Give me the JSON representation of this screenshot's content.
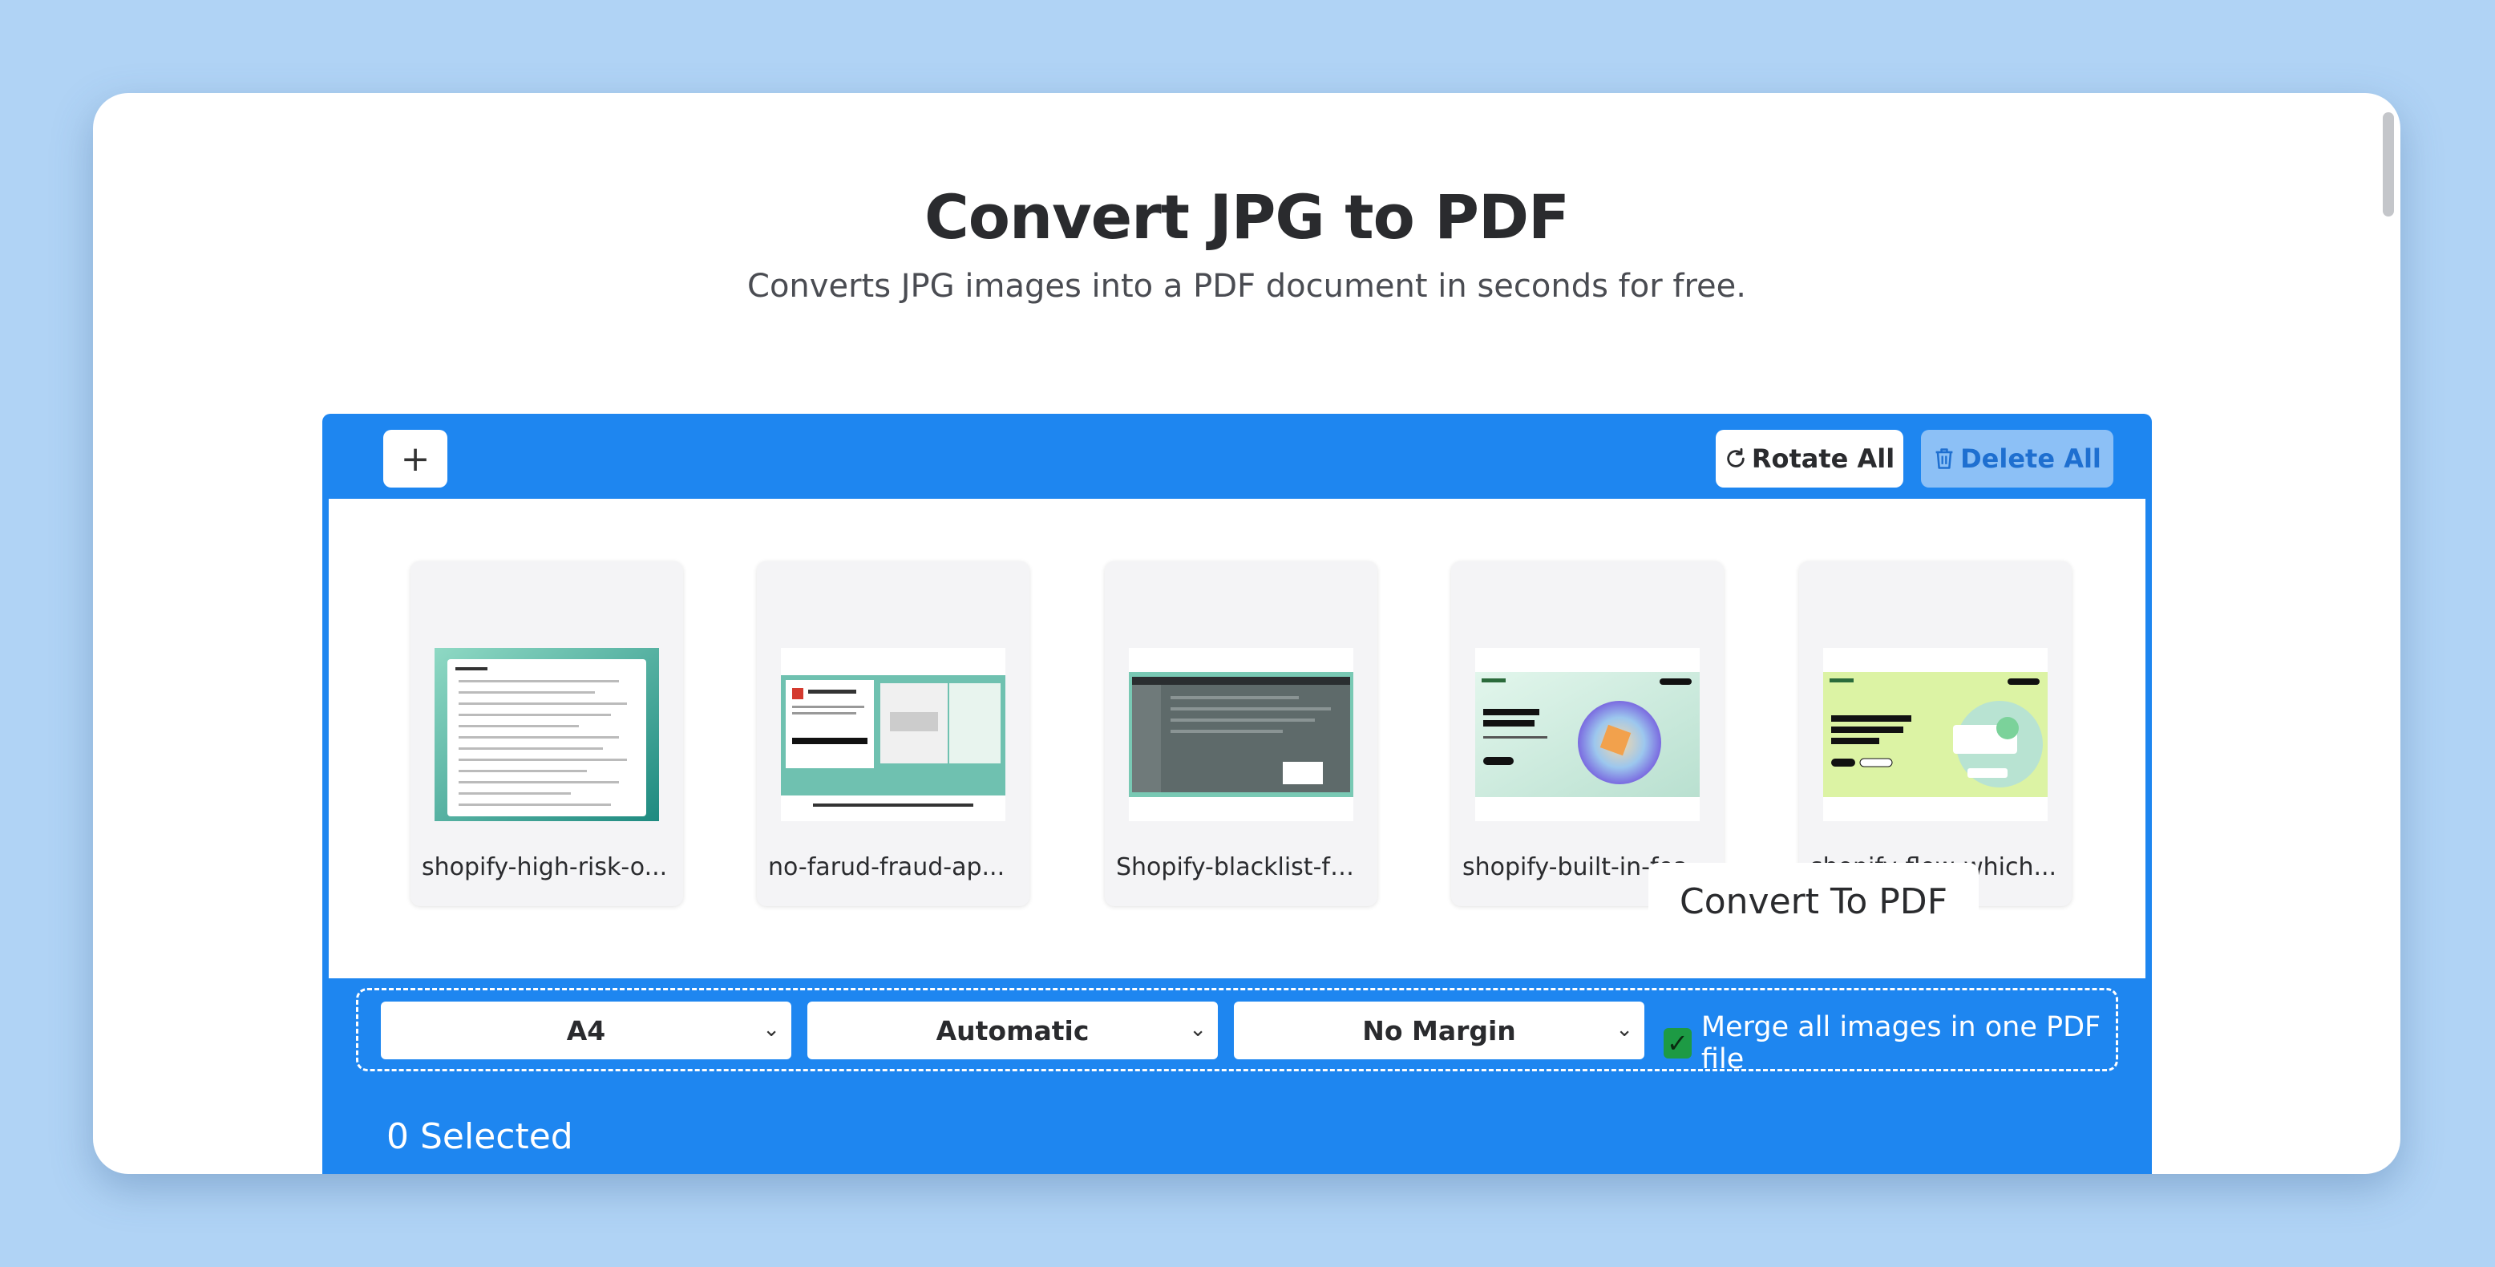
{
  "header": {
    "title": "Convert JPG to PDF",
    "subtitle": "Converts JPG images into a PDF document in seconds for free."
  },
  "toolbar": {
    "add_label": "+",
    "rotate_all_label": "Rotate All",
    "delete_all_label": "Delete All"
  },
  "files": [
    {
      "name": "shopify-high-risk-o..."
    },
    {
      "name": "no-farud-fraud-ap..."
    },
    {
      "name": "Shopify-blacklist-fe..."
    },
    {
      "name": "shopify-built-in-fea..."
    },
    {
      "name": "shopify-flow-which..."
    }
  ],
  "options": {
    "page_size": "A4",
    "orientation": "Automatic",
    "margin": "No Margin",
    "merge_label": "Merge all images in one PDF file",
    "merge_checked": true
  },
  "footer": {
    "selected_count": "0 Selected",
    "convert_label": "Convert To PDF"
  },
  "colors": {
    "background": "#b0d3f5",
    "panel": "#1e86f0",
    "delete_disabled": "#8cc0f6",
    "checkbox": "#1d9a44"
  }
}
